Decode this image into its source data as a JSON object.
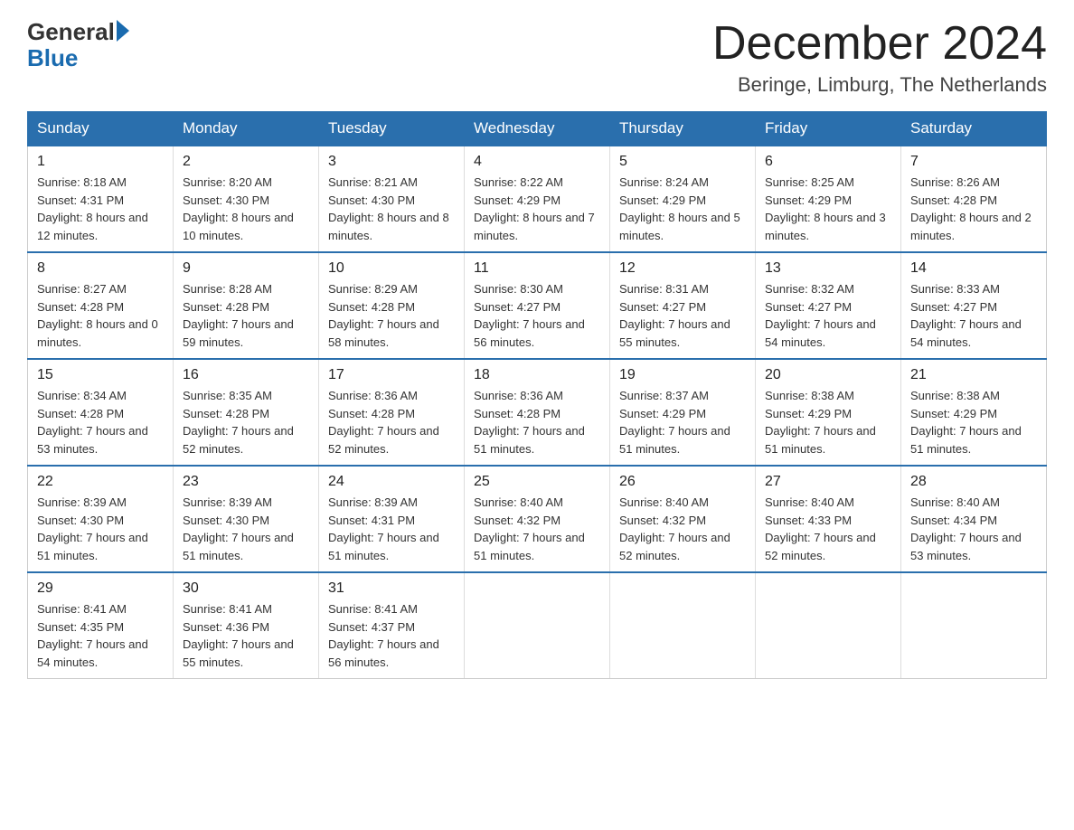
{
  "header": {
    "logo_general": "General",
    "logo_blue": "Blue",
    "month_title": "December 2024",
    "location": "Beringe, Limburg, The Netherlands"
  },
  "days_of_week": [
    "Sunday",
    "Monday",
    "Tuesday",
    "Wednesday",
    "Thursday",
    "Friday",
    "Saturday"
  ],
  "weeks": [
    [
      {
        "day": "1",
        "sunrise": "8:18 AM",
        "sunset": "4:31 PM",
        "daylight": "8 hours and 12 minutes."
      },
      {
        "day": "2",
        "sunrise": "8:20 AM",
        "sunset": "4:30 PM",
        "daylight": "8 hours and 10 minutes."
      },
      {
        "day": "3",
        "sunrise": "8:21 AM",
        "sunset": "4:30 PM",
        "daylight": "8 hours and 8 minutes."
      },
      {
        "day": "4",
        "sunrise": "8:22 AM",
        "sunset": "4:29 PM",
        "daylight": "8 hours and 7 minutes."
      },
      {
        "day": "5",
        "sunrise": "8:24 AM",
        "sunset": "4:29 PM",
        "daylight": "8 hours and 5 minutes."
      },
      {
        "day": "6",
        "sunrise": "8:25 AM",
        "sunset": "4:29 PM",
        "daylight": "8 hours and 3 minutes."
      },
      {
        "day": "7",
        "sunrise": "8:26 AM",
        "sunset": "4:28 PM",
        "daylight": "8 hours and 2 minutes."
      }
    ],
    [
      {
        "day": "8",
        "sunrise": "8:27 AM",
        "sunset": "4:28 PM",
        "daylight": "8 hours and 0 minutes."
      },
      {
        "day": "9",
        "sunrise": "8:28 AM",
        "sunset": "4:28 PM",
        "daylight": "7 hours and 59 minutes."
      },
      {
        "day": "10",
        "sunrise": "8:29 AM",
        "sunset": "4:28 PM",
        "daylight": "7 hours and 58 minutes."
      },
      {
        "day": "11",
        "sunrise": "8:30 AM",
        "sunset": "4:27 PM",
        "daylight": "7 hours and 56 minutes."
      },
      {
        "day": "12",
        "sunrise": "8:31 AM",
        "sunset": "4:27 PM",
        "daylight": "7 hours and 55 minutes."
      },
      {
        "day": "13",
        "sunrise": "8:32 AM",
        "sunset": "4:27 PM",
        "daylight": "7 hours and 54 minutes."
      },
      {
        "day": "14",
        "sunrise": "8:33 AM",
        "sunset": "4:27 PM",
        "daylight": "7 hours and 54 minutes."
      }
    ],
    [
      {
        "day": "15",
        "sunrise": "8:34 AM",
        "sunset": "4:28 PM",
        "daylight": "7 hours and 53 minutes."
      },
      {
        "day": "16",
        "sunrise": "8:35 AM",
        "sunset": "4:28 PM",
        "daylight": "7 hours and 52 minutes."
      },
      {
        "day": "17",
        "sunrise": "8:36 AM",
        "sunset": "4:28 PM",
        "daylight": "7 hours and 52 minutes."
      },
      {
        "day": "18",
        "sunrise": "8:36 AM",
        "sunset": "4:28 PM",
        "daylight": "7 hours and 51 minutes."
      },
      {
        "day": "19",
        "sunrise": "8:37 AM",
        "sunset": "4:29 PM",
        "daylight": "7 hours and 51 minutes."
      },
      {
        "day": "20",
        "sunrise": "8:38 AM",
        "sunset": "4:29 PM",
        "daylight": "7 hours and 51 minutes."
      },
      {
        "day": "21",
        "sunrise": "8:38 AM",
        "sunset": "4:29 PM",
        "daylight": "7 hours and 51 minutes."
      }
    ],
    [
      {
        "day": "22",
        "sunrise": "8:39 AM",
        "sunset": "4:30 PM",
        "daylight": "7 hours and 51 minutes."
      },
      {
        "day": "23",
        "sunrise": "8:39 AM",
        "sunset": "4:30 PM",
        "daylight": "7 hours and 51 minutes."
      },
      {
        "day": "24",
        "sunrise": "8:39 AM",
        "sunset": "4:31 PM",
        "daylight": "7 hours and 51 minutes."
      },
      {
        "day": "25",
        "sunrise": "8:40 AM",
        "sunset": "4:32 PM",
        "daylight": "7 hours and 51 minutes."
      },
      {
        "day": "26",
        "sunrise": "8:40 AM",
        "sunset": "4:32 PM",
        "daylight": "7 hours and 52 minutes."
      },
      {
        "day": "27",
        "sunrise": "8:40 AM",
        "sunset": "4:33 PM",
        "daylight": "7 hours and 52 minutes."
      },
      {
        "day": "28",
        "sunrise": "8:40 AM",
        "sunset": "4:34 PM",
        "daylight": "7 hours and 53 minutes."
      }
    ],
    [
      {
        "day": "29",
        "sunrise": "8:41 AM",
        "sunset": "4:35 PM",
        "daylight": "7 hours and 54 minutes."
      },
      {
        "day": "30",
        "sunrise": "8:41 AM",
        "sunset": "4:36 PM",
        "daylight": "7 hours and 55 minutes."
      },
      {
        "day": "31",
        "sunrise": "8:41 AM",
        "sunset": "4:37 PM",
        "daylight": "7 hours and 56 minutes."
      },
      null,
      null,
      null,
      null
    ]
  ],
  "labels": {
    "sunrise": "Sunrise: ",
    "sunset": "Sunset: ",
    "daylight": "Daylight: "
  }
}
